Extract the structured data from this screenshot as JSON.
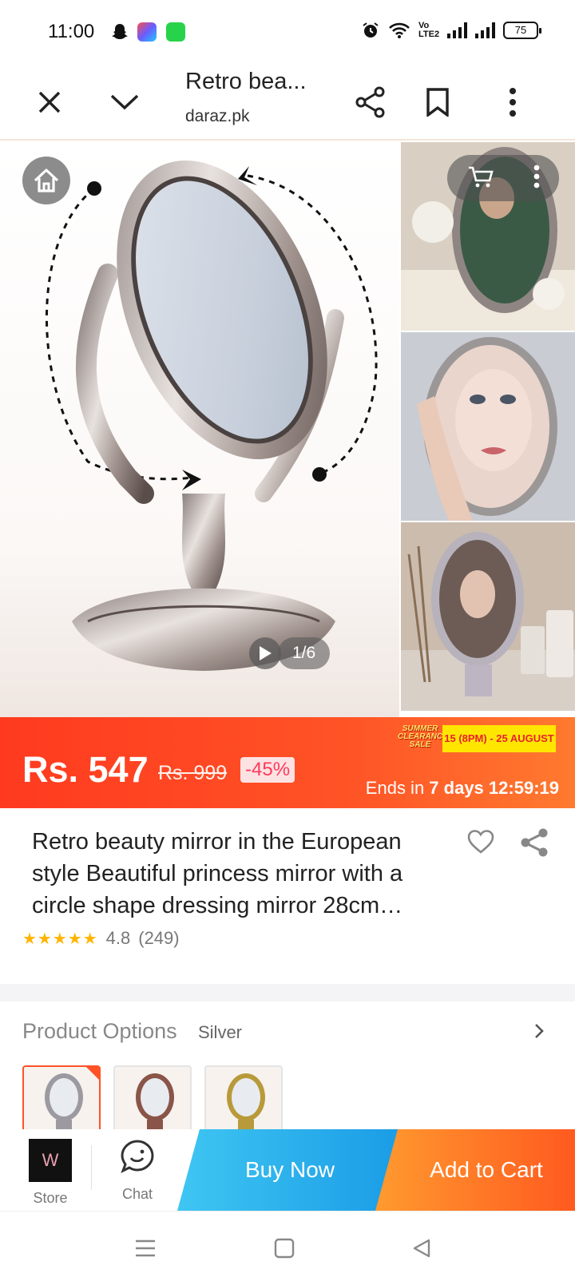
{
  "status_bar": {
    "time": "11:00",
    "network": "Vo LTE2",
    "battery": "75",
    "icons": [
      "snapchat-icon",
      "app-icon",
      "app-icon",
      "alarm-icon",
      "wifi-icon",
      "signal-icon",
      "signal-icon",
      "battery-icon"
    ]
  },
  "browser": {
    "page_title": "Retro bea...",
    "domain": "daraz.pk",
    "icons": [
      "close-icon",
      "chevron-down-icon",
      "share-icon",
      "bookmark-icon",
      "more-vertical-icon"
    ]
  },
  "gallery": {
    "counter": "1/6",
    "icons": [
      "home-icon",
      "cart-icon",
      "more-vertical-icon",
      "play-icon"
    ]
  },
  "price_banner": {
    "price": "Rs. 547",
    "original_price": "Rs. 999",
    "discount": "-45%",
    "sale_logo_line1": "SUMMER",
    "sale_logo_line2": "CLEARANCE",
    "sale_logo_line3": "SALE",
    "sale_dates": "15 (8PM) - 25 AUGUST",
    "ends_prefix": "Ends in ",
    "ends_days": "7 days",
    "ends_time": "12:59:19"
  },
  "product": {
    "title": "Retro beauty mirror in the European style Beautiful princess mirror with a circle shape dressing mirror 28cm…",
    "rating": "4.8",
    "reviews": "(249)",
    "stars": "★★★★★"
  },
  "options": {
    "title": "Product Options",
    "selected": "Silver"
  },
  "actions": {
    "store_label": "Store",
    "chat_label": "Chat",
    "buy_now": "Buy Now",
    "add_to_cart": "Add to Cart"
  },
  "colors": {
    "brand_orange": "#ff5326",
    "buy_blue": "#1a9ce6",
    "cart_orange": "#ff7a2f",
    "star_yellow": "#ffb400",
    "sale_yellow": "#ffe600"
  }
}
